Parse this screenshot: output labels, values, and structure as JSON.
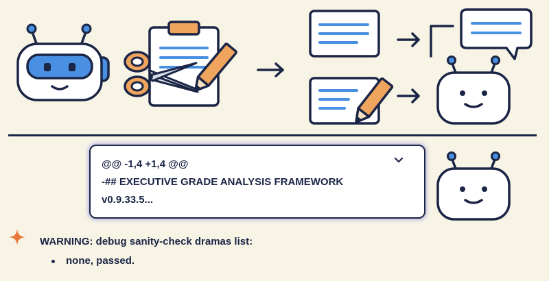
{
  "diff_panel": {
    "line1": "@@ -1,4 +1,4 @@",
    "line2": "-## EXECUTIVE GRADE ANALYSIS FRAMEWORK",
    "line3": "v0.9.33.5..."
  },
  "message": {
    "warning": "WARNING: debug sanity-check dramas list:",
    "items": [
      "none, passed."
    ]
  },
  "icons": {
    "robot": "robot-icon",
    "clipboard": "clipboard-icon",
    "scissors": "scissors-icon",
    "pencil": "pencil-icon",
    "arrow": "arrow-right-icon",
    "doc": "document-icon",
    "speech": "speech-bubble-icon",
    "spark": "sparkle-icon",
    "chevron": "chevron-down-icon"
  },
  "colors": {
    "background": "#f7f4e6",
    "outline": "#1b2545",
    "blue": "#4a90e2",
    "orange": "#f0a55e",
    "accent_spark": "#e8793a"
  }
}
